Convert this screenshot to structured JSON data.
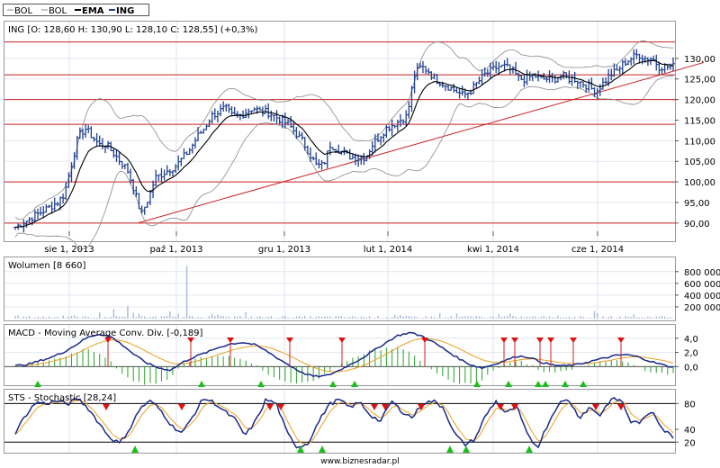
{
  "legend": {
    "items": [
      {
        "label": "BOL",
        "color": "#888888",
        "bold": false
      },
      {
        "label": "BOL",
        "color": "#888888",
        "bold": false
      },
      {
        "label": "EMA",
        "color": "#000000",
        "bold": true
      },
      {
        "label": "ING",
        "color": "#1f3f8f",
        "bold": true
      }
    ]
  },
  "footer": "www.biznesradar.pl",
  "chart_data": [
    {
      "id": "price",
      "type": "line",
      "title": "ING [O: 128,60  H: 130,90  L: 128,10  C: 128,55] (+0,3%)",
      "x_ticks": [
        "sie 1, 2013",
        "paź 1, 2013",
        "gru 1, 2013",
        "lut 1, 2014",
        "kwi 1, 2014",
        "cze 1, 2014"
      ],
      "y_ticks": [
        "90,00",
        "95,00",
        "100,00",
        "105,00",
        "110,00",
        "115,00",
        "120,00",
        "125,00",
        "130,00"
      ],
      "ylim": [
        88,
        135
      ],
      "horizontal_levels": [
        90,
        100,
        114,
        120,
        126,
        134
      ],
      "trendline": {
        "from": [
          0.185,
          90
        ],
        "to": [
          1.0,
          127
        ]
      },
      "colors": {
        "price": "#1f3f8f",
        "ema": "#000000",
        "bollinger": "#888888",
        "levels": "#cc2222"
      },
      "series": [
        {
          "name": "ING",
          "values": [
            89,
            90,
            91,
            92,
            93,
            94,
            95,
            97,
            104,
            111,
            113,
            111,
            109,
            109,
            107,
            105,
            103,
            98,
            92,
            96,
            101,
            102,
            103,
            104,
            106,
            108,
            111,
            113,
            116,
            117,
            118,
            116,
            116,
            117,
            118,
            117,
            117,
            116,
            115,
            114,
            112,
            110,
            107,
            104,
            104,
            109,
            108,
            107,
            106,
            106,
            106,
            109,
            111,
            113,
            114,
            115,
            116,
            126,
            128,
            127,
            125,
            124,
            123,
            122,
            121,
            122,
            124,
            126,
            127,
            128,
            128,
            127,
            125,
            125,
            126,
            125,
            125,
            125,
            126,
            125,
            125,
            124,
            123,
            122,
            124,
            126,
            127,
            129,
            130,
            131,
            130,
            130,
            128,
            128,
            128
          ]
        }
      ]
    },
    {
      "id": "volume",
      "type": "bar",
      "title": "Wolumen [8 660]",
      "y_ticks": [
        "200 000",
        "400 000",
        "600 000",
        "800 000"
      ],
      "ylim": [
        0,
        950000
      ]
    },
    {
      "id": "macd",
      "type": "line",
      "title": "MACD - Moving Average Conv. Div. [-0,189]",
      "y_ticks": [
        "0,0",
        "2,0",
        "4,0"
      ],
      "ylim": [
        -2.5,
        5.5
      ],
      "series": [
        {
          "name": "MACD",
          "values": [
            0.1,
            0.3,
            0.8,
            1.3,
            2.0,
            3.0,
            4.1,
            4.6,
            4.2,
            3.0,
            1.6,
            0.5,
            -0.2,
            -0.5,
            0.6,
            1.4,
            2.0,
            2.7,
            3.2,
            3.4,
            3.1,
            2.2,
            1.1,
            0.1,
            -0.9,
            -1.4,
            -1.3,
            -0.6,
            0.3,
            1.2,
            2.3,
            3.4,
            4.4,
            4.8,
            4.3,
            3.4,
            2.3,
            1.2,
            0.3,
            -0.2,
            0.3,
            0.9,
            1.5,
            1.3,
            0.6,
            0.2,
            0.1,
            0.3,
            0.7,
            1.1,
            1.5,
            1.7,
            1.4,
            0.8,
            0.3,
            -0.1
          ]
        }
      ]
    },
    {
      "id": "stochastic",
      "type": "line",
      "title": "STS - Stochastic [28,24]",
      "y_ticks": [
        "20",
        "40",
        "80"
      ],
      "ylim": [
        5,
        100
      ],
      "levels": [
        20,
        80
      ],
      "series": [
        {
          "name": "%K",
          "values": [
            35,
            62,
            82,
            80,
            84,
            79,
            88,
            72,
            50,
            28,
            18,
            42,
            74,
            84,
            68,
            45,
            34,
            60,
            88,
            82,
            68,
            56,
            30,
            52,
            86,
            80,
            35,
            12,
            18,
            50,
            78,
            86,
            74,
            82,
            62,
            52,
            84,
            68,
            58,
            80,
            84,
            74,
            35,
            16,
            24,
            60,
            84,
            64,
            76,
            32,
            12,
            48,
            80,
            86,
            58,
            74,
            62,
            86,
            86,
            50,
            52,
            70,
            40,
            28
          ]
        }
      ]
    }
  ]
}
